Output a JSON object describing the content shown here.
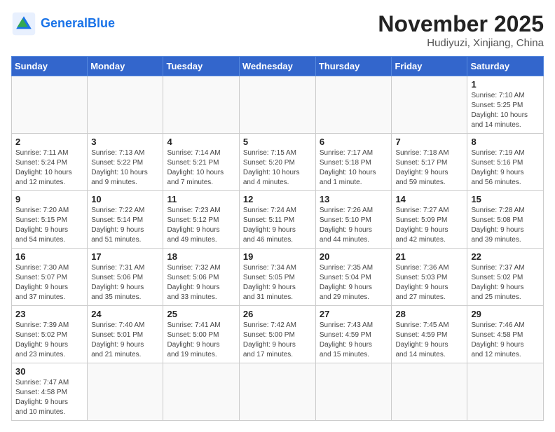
{
  "header": {
    "logo_general": "General",
    "logo_blue": "Blue",
    "month_title": "November 2025",
    "location": "Hudiyuzi, Xinjiang, China"
  },
  "weekdays": [
    "Sunday",
    "Monday",
    "Tuesday",
    "Wednesday",
    "Thursday",
    "Friday",
    "Saturday"
  ],
  "weeks": [
    [
      {
        "day": "",
        "info": ""
      },
      {
        "day": "",
        "info": ""
      },
      {
        "day": "",
        "info": ""
      },
      {
        "day": "",
        "info": ""
      },
      {
        "day": "",
        "info": ""
      },
      {
        "day": "",
        "info": ""
      },
      {
        "day": "1",
        "info": "Sunrise: 7:10 AM\nSunset: 5:25 PM\nDaylight: 10 hours\nand 14 minutes."
      }
    ],
    [
      {
        "day": "2",
        "info": "Sunrise: 7:11 AM\nSunset: 5:24 PM\nDaylight: 10 hours\nand 12 minutes."
      },
      {
        "day": "3",
        "info": "Sunrise: 7:13 AM\nSunset: 5:22 PM\nDaylight: 10 hours\nand 9 minutes."
      },
      {
        "day": "4",
        "info": "Sunrise: 7:14 AM\nSunset: 5:21 PM\nDaylight: 10 hours\nand 7 minutes."
      },
      {
        "day": "5",
        "info": "Sunrise: 7:15 AM\nSunset: 5:20 PM\nDaylight: 10 hours\nand 4 minutes."
      },
      {
        "day": "6",
        "info": "Sunrise: 7:17 AM\nSunset: 5:18 PM\nDaylight: 10 hours\nand 1 minute."
      },
      {
        "day": "7",
        "info": "Sunrise: 7:18 AM\nSunset: 5:17 PM\nDaylight: 9 hours\nand 59 minutes."
      },
      {
        "day": "8",
        "info": "Sunrise: 7:19 AM\nSunset: 5:16 PM\nDaylight: 9 hours\nand 56 minutes."
      }
    ],
    [
      {
        "day": "9",
        "info": "Sunrise: 7:20 AM\nSunset: 5:15 PM\nDaylight: 9 hours\nand 54 minutes."
      },
      {
        "day": "10",
        "info": "Sunrise: 7:22 AM\nSunset: 5:14 PM\nDaylight: 9 hours\nand 51 minutes."
      },
      {
        "day": "11",
        "info": "Sunrise: 7:23 AM\nSunset: 5:12 PM\nDaylight: 9 hours\nand 49 minutes."
      },
      {
        "day": "12",
        "info": "Sunrise: 7:24 AM\nSunset: 5:11 PM\nDaylight: 9 hours\nand 46 minutes."
      },
      {
        "day": "13",
        "info": "Sunrise: 7:26 AM\nSunset: 5:10 PM\nDaylight: 9 hours\nand 44 minutes."
      },
      {
        "day": "14",
        "info": "Sunrise: 7:27 AM\nSunset: 5:09 PM\nDaylight: 9 hours\nand 42 minutes."
      },
      {
        "day": "15",
        "info": "Sunrise: 7:28 AM\nSunset: 5:08 PM\nDaylight: 9 hours\nand 39 minutes."
      }
    ],
    [
      {
        "day": "16",
        "info": "Sunrise: 7:30 AM\nSunset: 5:07 PM\nDaylight: 9 hours\nand 37 minutes."
      },
      {
        "day": "17",
        "info": "Sunrise: 7:31 AM\nSunset: 5:06 PM\nDaylight: 9 hours\nand 35 minutes."
      },
      {
        "day": "18",
        "info": "Sunrise: 7:32 AM\nSunset: 5:06 PM\nDaylight: 9 hours\nand 33 minutes."
      },
      {
        "day": "19",
        "info": "Sunrise: 7:34 AM\nSunset: 5:05 PM\nDaylight: 9 hours\nand 31 minutes."
      },
      {
        "day": "20",
        "info": "Sunrise: 7:35 AM\nSunset: 5:04 PM\nDaylight: 9 hours\nand 29 minutes."
      },
      {
        "day": "21",
        "info": "Sunrise: 7:36 AM\nSunset: 5:03 PM\nDaylight: 9 hours\nand 27 minutes."
      },
      {
        "day": "22",
        "info": "Sunrise: 7:37 AM\nSunset: 5:02 PM\nDaylight: 9 hours\nand 25 minutes."
      }
    ],
    [
      {
        "day": "23",
        "info": "Sunrise: 7:39 AM\nSunset: 5:02 PM\nDaylight: 9 hours\nand 23 minutes."
      },
      {
        "day": "24",
        "info": "Sunrise: 7:40 AM\nSunset: 5:01 PM\nDaylight: 9 hours\nand 21 minutes."
      },
      {
        "day": "25",
        "info": "Sunrise: 7:41 AM\nSunset: 5:00 PM\nDaylight: 9 hours\nand 19 minutes."
      },
      {
        "day": "26",
        "info": "Sunrise: 7:42 AM\nSunset: 5:00 PM\nDaylight: 9 hours\nand 17 minutes."
      },
      {
        "day": "27",
        "info": "Sunrise: 7:43 AM\nSunset: 4:59 PM\nDaylight: 9 hours\nand 15 minutes."
      },
      {
        "day": "28",
        "info": "Sunrise: 7:45 AM\nSunset: 4:59 PM\nDaylight: 9 hours\nand 14 minutes."
      },
      {
        "day": "29",
        "info": "Sunrise: 7:46 AM\nSunset: 4:58 PM\nDaylight: 9 hours\nand 12 minutes."
      }
    ],
    [
      {
        "day": "30",
        "info": "Sunrise: 7:47 AM\nSunset: 4:58 PM\nDaylight: 9 hours\nand 10 minutes."
      },
      {
        "day": "",
        "info": ""
      },
      {
        "day": "",
        "info": ""
      },
      {
        "day": "",
        "info": ""
      },
      {
        "day": "",
        "info": ""
      },
      {
        "day": "",
        "info": ""
      },
      {
        "day": "",
        "info": ""
      }
    ]
  ]
}
